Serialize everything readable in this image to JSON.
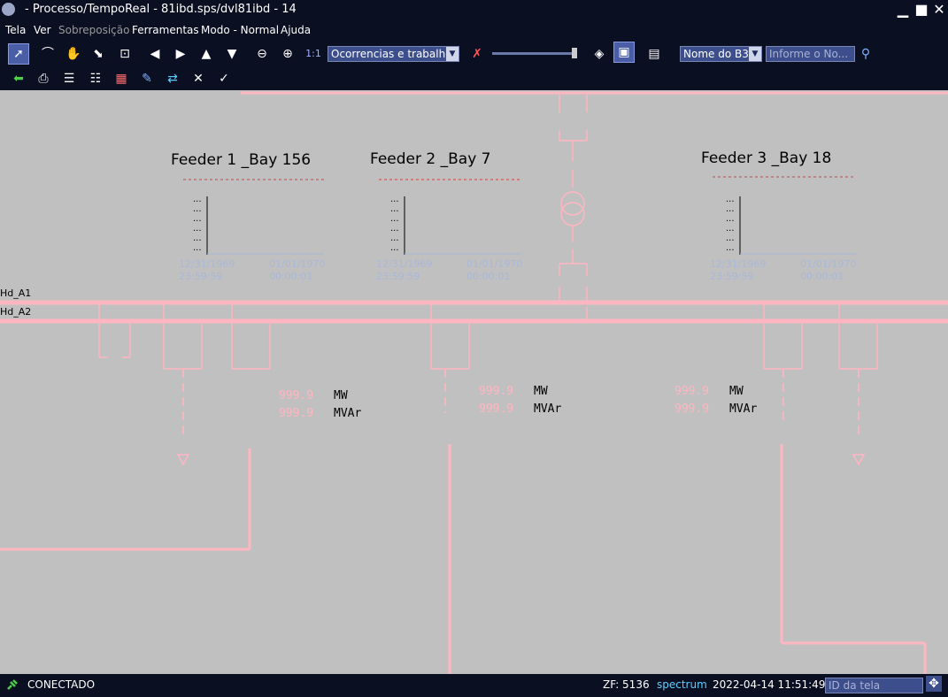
{
  "window": {
    "title": " - Processo/TempoReal - 81ibd.sps/dvl81ibd - 14"
  },
  "menu": [
    "Tela",
    "Ver",
    "Sobreposição",
    "Ferramentas",
    "Modo - Normal",
    "Ajuda"
  ],
  "toolbar": {
    "zoom_ratio": "1:1",
    "overlay_select": "Ocorrencias e trabalhos",
    "name_select": "Nome do B3",
    "search_placeholder": "Informe o No..."
  },
  "diagram": {
    "feeders": [
      {
        "title": "Feeder 1 _Bay 156",
        "ts_start_date": "12/31/1969",
        "ts_start_time": "23:59:59",
        "ts_end_date": "01/01/1970",
        "ts_end_time": "00:00:01",
        "mw": "999.9",
        "mvar": "999.9"
      },
      {
        "title": "Feeder 2 _Bay 7",
        "ts_start_date": "12/31/1969",
        "ts_start_time": "23:59:59",
        "ts_end_date": "01/01/1970",
        "ts_end_time": "00:00:01",
        "mw": "999.9",
        "mvar": "999.9"
      },
      {
        "title": "Feeder 3 _Bay 18",
        "ts_start_date": "12/31/1969",
        "ts_start_time": "23:59:59",
        "ts_end_date": "01/01/1970",
        "ts_end_time": "00:00:01",
        "mw": "999.9",
        "mvar": "999.9"
      }
    ],
    "bus_a1": "Hd_A1",
    "bus_a2": "Hd_A2",
    "unit_mw": "MW",
    "unit_mvar": "MVAr",
    "axis_tick": "...",
    "line_color": "#ffb6c1"
  },
  "status": {
    "connection": "CONECTADO",
    "zf": "ZF: 5136",
    "user": "spectrum",
    "datetime": "2022-04-14 11:51:49",
    "screen_id_placeholder": "ID da tela"
  }
}
